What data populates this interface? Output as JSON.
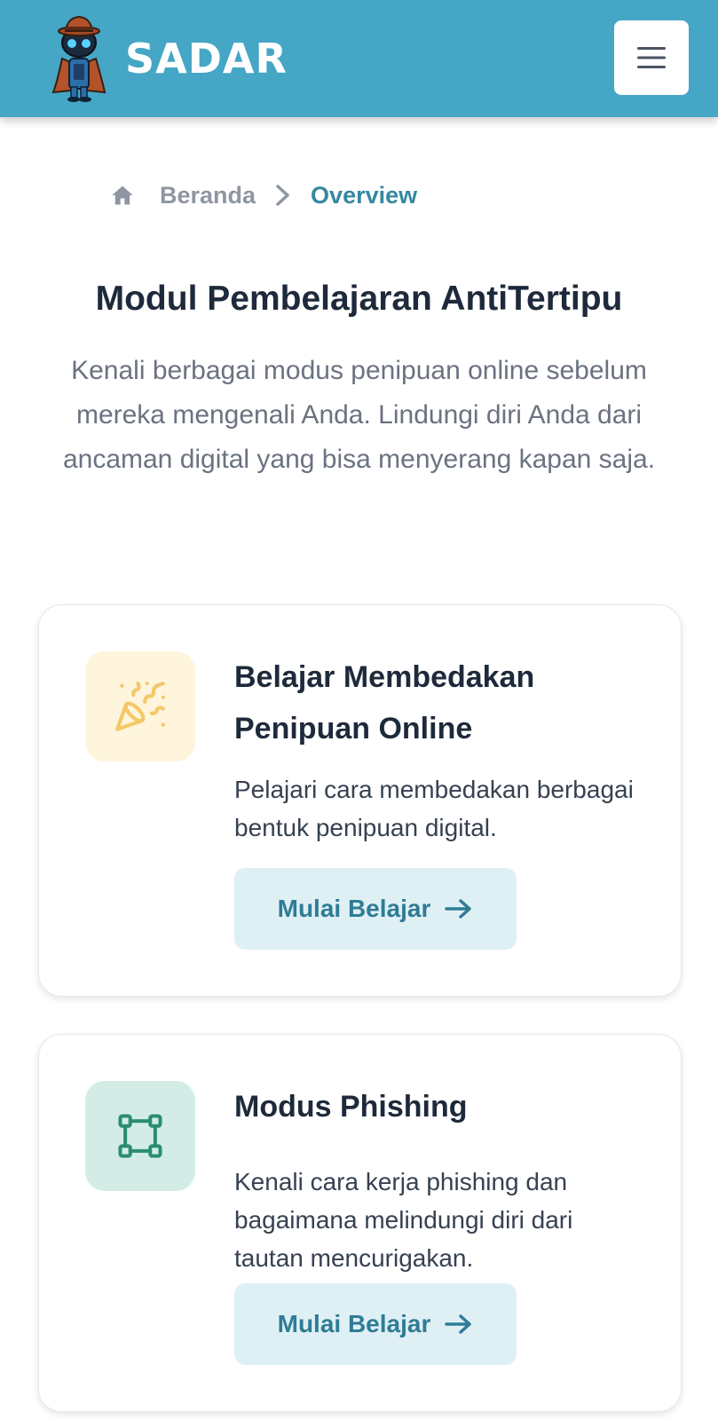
{
  "header": {
    "brand": "SADAR",
    "logo_icon": "detective-robot-mascot-icon",
    "menu_icon": "hamburger-menu-icon"
  },
  "breadcrumb": {
    "home_icon": "home-icon",
    "home_label": "Beranda",
    "separator_icon": "chevron-right-icon",
    "current_label": "Overview"
  },
  "page": {
    "title": "Modul Pembelajaran AntiTertipu",
    "description": "Kenali berbagai modus penipuan online sebelum mereka mengenali Anda. Lindungi diri Anda dari ancaman digital yang bisa menyerang kapan saja."
  },
  "modules": [
    {
      "icon": "party-popper-icon",
      "title": "Belajar Membedakan Penipuan Online",
      "description": "Pelajari cara membedakan berbagai bentuk penipuan digital.",
      "button_label": "Mulai Belajar",
      "button_icon": "arrow-right-icon"
    },
    {
      "icon": "node-square-icon",
      "title": "Modus Phishing",
      "description": "Kenali cara kerja phishing dan bagaimana melindungi diri dari tautan mencurigakan.",
      "button_label": "Mulai Belajar",
      "button_icon": "arrow-right-icon"
    }
  ],
  "colors": {
    "header_bg": "#45a6c6",
    "accent": "#36889f",
    "button_bg": "#dff0f5",
    "icon_bg_yellow": "#fff4dc",
    "icon_bg_green": "#d3ede6"
  }
}
